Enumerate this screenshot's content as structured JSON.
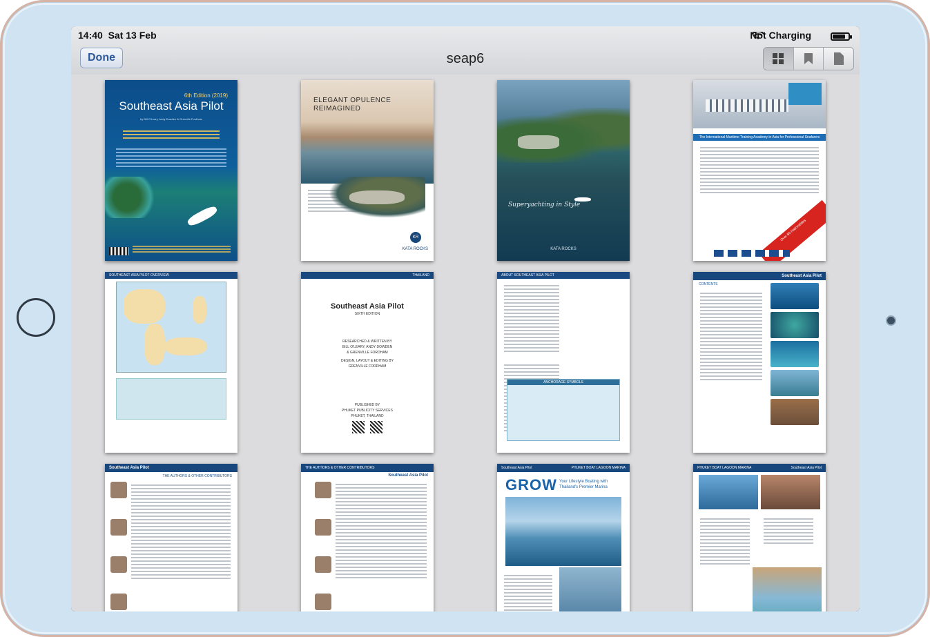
{
  "status_bar": {
    "time": "14:40",
    "date": "Sat 13 Feb",
    "charging": "Not Charging",
    "battery_level": 0.8
  },
  "nav": {
    "done_label": "Done",
    "title": "seap6",
    "view_icons": [
      "grid-icon",
      "bookmark-icon",
      "page-icon"
    ]
  },
  "pages": {
    "p1": {
      "edition": "6th Edition (2019)",
      "title": "Southeast Asia Pilot",
      "authors": "by Bill O'Leary, Andy Dowden & Grenville Fordham"
    },
    "p2": {
      "headline_1": "ELEGANT OPULENCE",
      "headline_2": "REIMAGINED",
      "logo_initials": "KR",
      "logo_text": "KATA ROCKS"
    },
    "p3": {
      "script": "Superyachting in Style",
      "brand": "KATA ROCKS"
    },
    "p4": {
      "banner": "The International Maritime Training Academy in Asia for Professional Seafarers",
      "tag": "Over 80 Nationalities"
    },
    "p5": {
      "header": "SOUTHEAST ASIA PILOT OVERVIEW"
    },
    "p6": {
      "header": "THAILAND",
      "title": "Southeast Asia Pilot",
      "edition": "SIXTH EDITION",
      "credit_1": "RESEARCHED & WRITTEN BY",
      "credit_2": "BILL O'LEARY, ANDY DOWDEN",
      "credit_3": "& GRENVILLE FORDHAM",
      "credit_4": "DESIGN, LAYOUT & EDITING BY",
      "credit_5": "GRENVILLE FORDHAM",
      "publisher_1": "PUBLISHED BY",
      "publisher_2": "PHUKET PUBLICITY SERVICES",
      "publisher_3": "PHUKET, THAILAND"
    },
    "p7": {
      "header": "ABOUT SOUTHEAST ASIA PILOT",
      "symbols": "ANCHORAGE SYMBOLS"
    },
    "p8": {
      "header": "CONTENTS",
      "title": "Southeast Asia Pilot"
    },
    "p9": {
      "header": "Southeast Asia Pilot",
      "sub": "THE AUTHORS & OTHER CONTRIBUTORS"
    },
    "p10": {
      "header": "THE AUTHORS & OTHER CONTRIBUTORS",
      "title": "Southeast Asia Pilot"
    },
    "p11": {
      "header": "Southeast Asia Pilot",
      "sub": "PHUKET BOAT LAGOON MARINA",
      "grow": "GROW",
      "tagline_1": "Your Lifestyle Boating with",
      "tagline_2": "Thailand's Premier Marina"
    },
    "p12": {
      "header": "PHUKET BOAT LAGOON MARINA",
      "title": "Southeast Asia Pilot"
    }
  }
}
